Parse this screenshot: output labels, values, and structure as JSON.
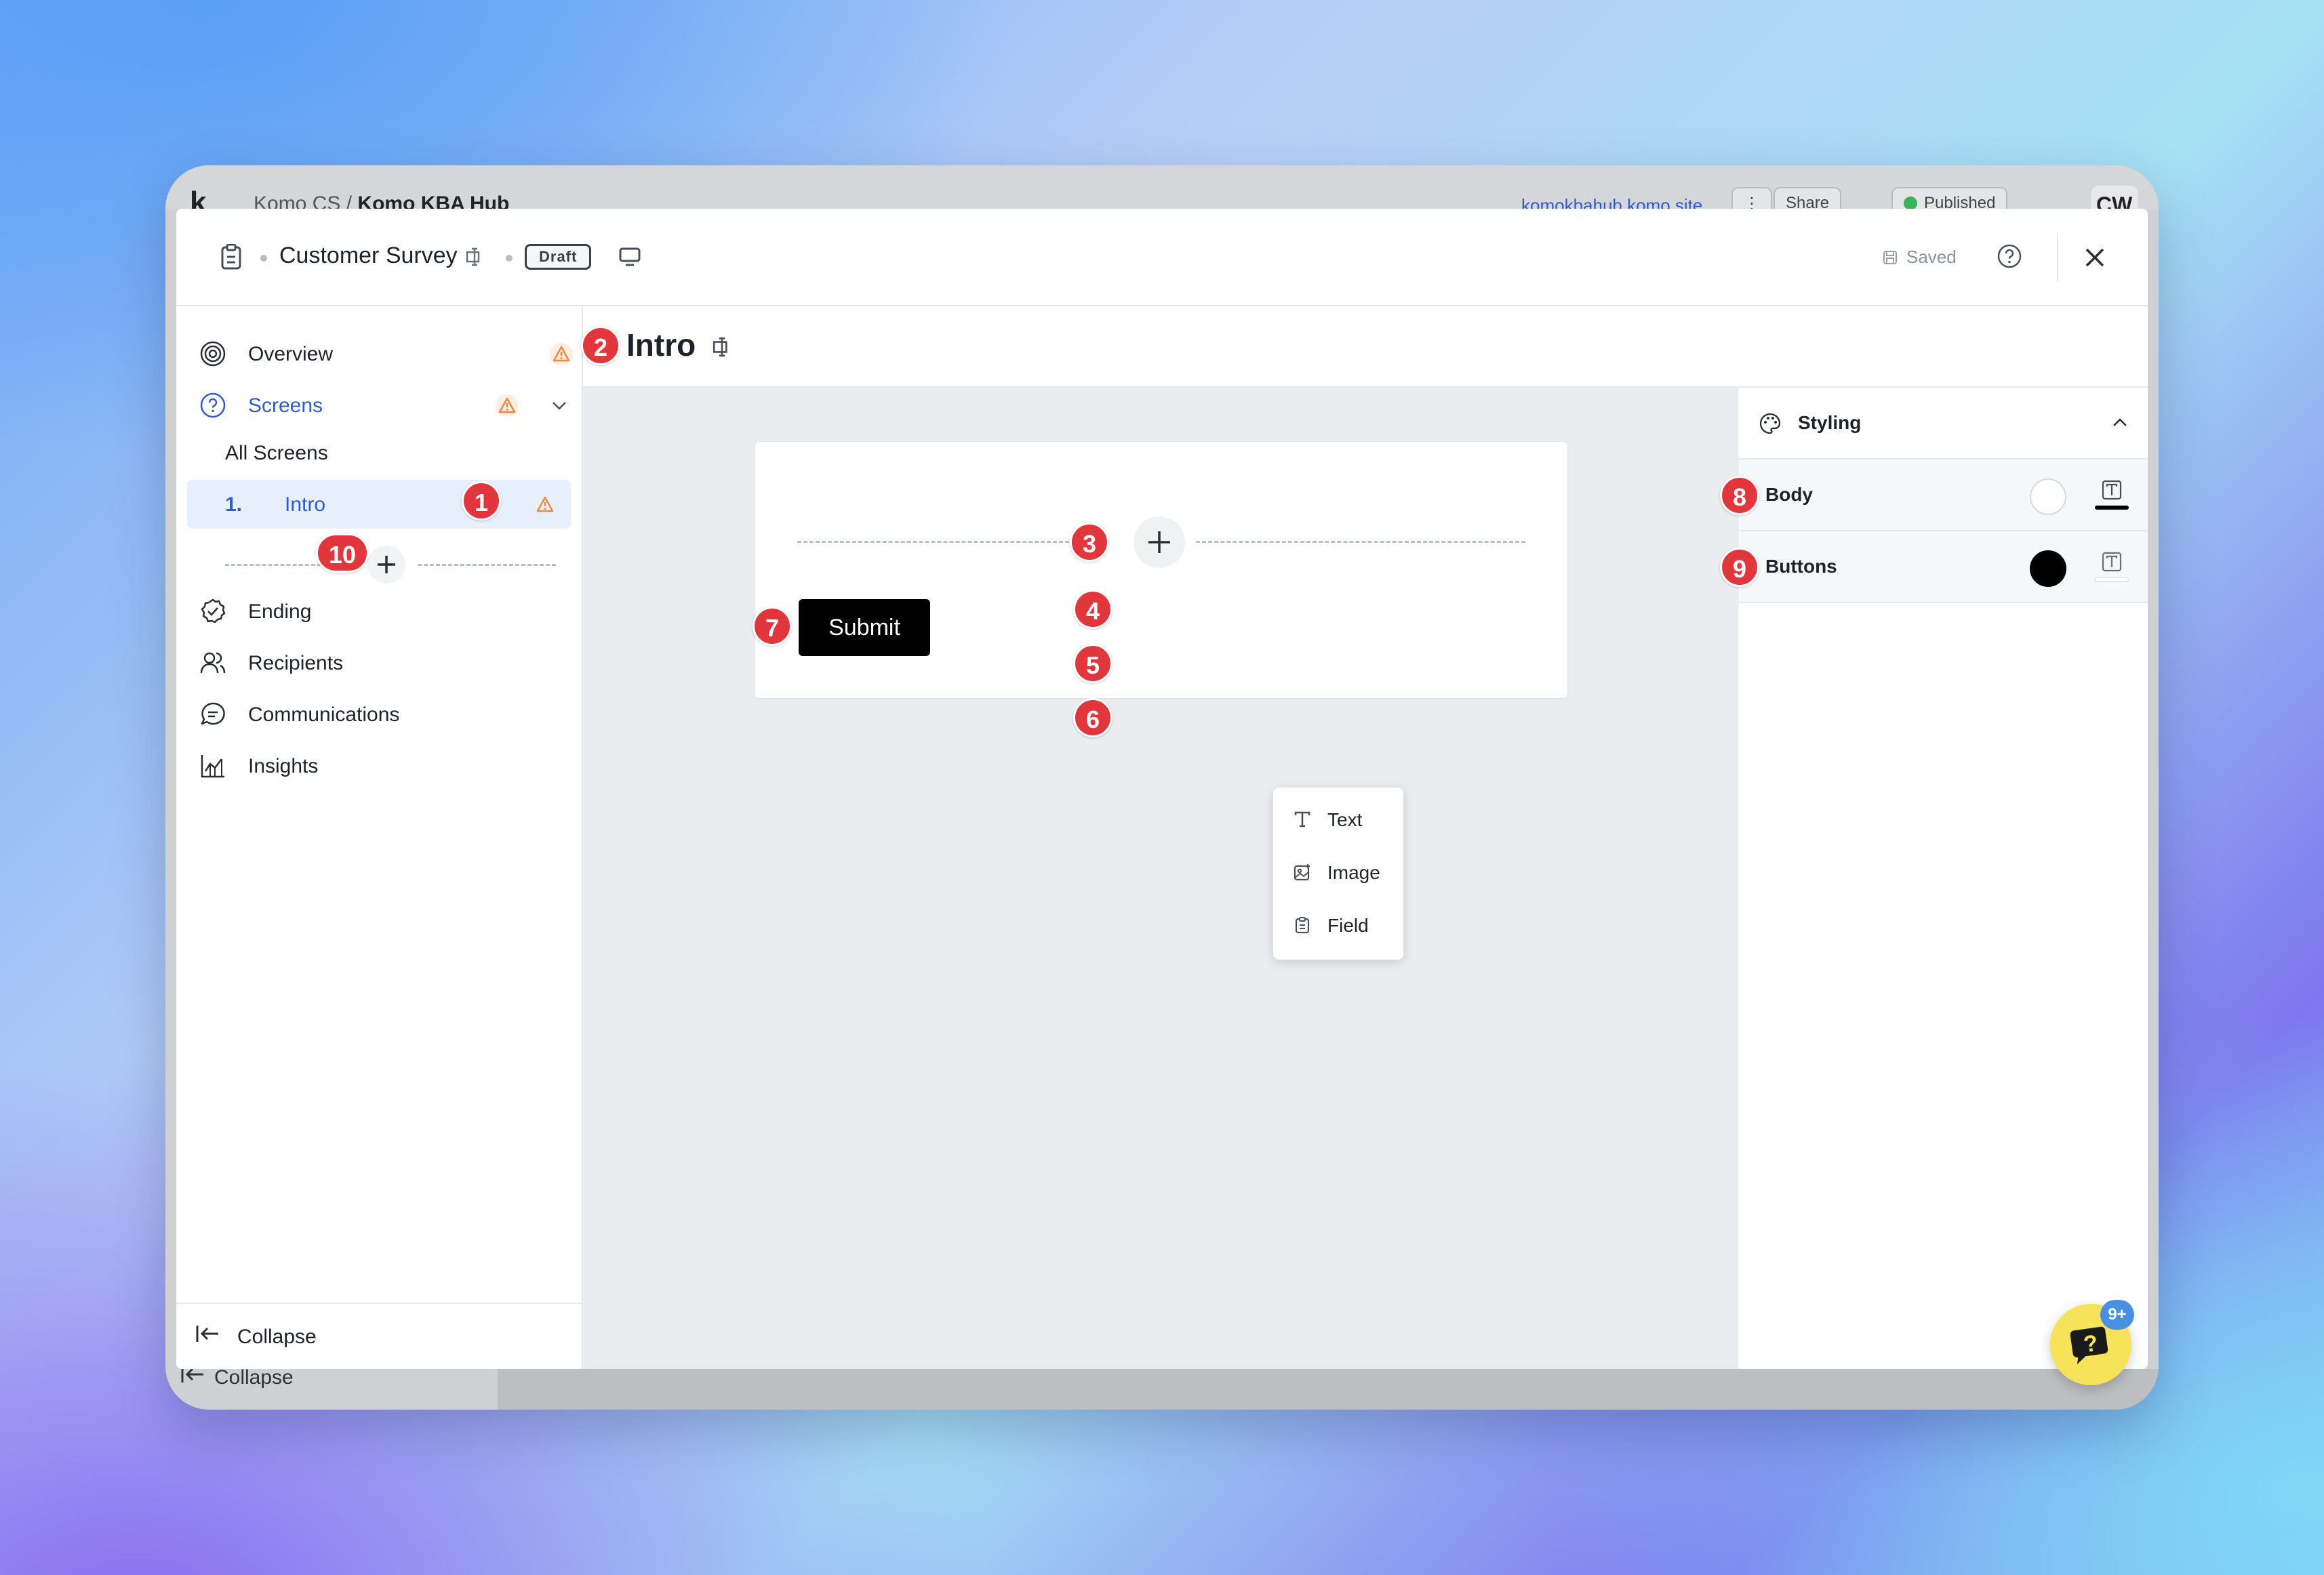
{
  "background_app": {
    "logo": "k",
    "breadcrumb_parent": "Komo CS",
    "breadcrumb_separator": "/",
    "breadcrumb_current": "Komo KBA Hub",
    "site_link": "komokbahub.komo.site",
    "more_button": "⋮",
    "share_button": "Share",
    "publish_status": "Published",
    "avatar_initials": "CW",
    "collapse_label": "Collapse"
  },
  "topbar": {
    "survey_title": "Customer Survey",
    "status_badge": "Draft",
    "saved_label": "Saved"
  },
  "sidebar": {
    "items": [
      {
        "label": "Overview",
        "icon": "target-icon",
        "warning": true
      },
      {
        "label": "Screens",
        "icon": "question-circle-icon",
        "warning": true,
        "expanded": true
      },
      {
        "label": "Ending",
        "icon": "check-circle-icon"
      },
      {
        "label": "Recipients",
        "icon": "users-icon"
      },
      {
        "label": "Communications",
        "icon": "chat-icon"
      },
      {
        "label": "Insights",
        "icon": "chart-icon"
      }
    ],
    "all_screens_label": "All Screens",
    "screens": [
      {
        "number": "1.",
        "label": "Intro",
        "warning": true
      }
    ],
    "collapse_label": "Collapse"
  },
  "main": {
    "page_title": "Intro",
    "submit_label": "Submit",
    "add_menu": [
      {
        "label": "Text",
        "icon": "text-icon"
      },
      {
        "label": "Image",
        "icon": "image-icon"
      },
      {
        "label": "Field",
        "icon": "clipboard-icon"
      }
    ]
  },
  "styling_panel": {
    "title": "Styling",
    "rows": [
      {
        "label": "Body",
        "swatch_color": "#ffffff",
        "underline_color": "#000000"
      },
      {
        "label": "Buttons",
        "swatch_color": "#000000",
        "underline_color": "#e5e7eb"
      }
    ]
  },
  "help_widget": {
    "badge": "9+"
  },
  "callouts": [
    "1",
    "2",
    "3",
    "4",
    "5",
    "6",
    "7",
    "8",
    "9",
    "10"
  ],
  "colors": {
    "accent": "#2f5bd0",
    "warning": "#f0883e",
    "callout": "#e0363c",
    "active_bg": "#e8effc"
  }
}
